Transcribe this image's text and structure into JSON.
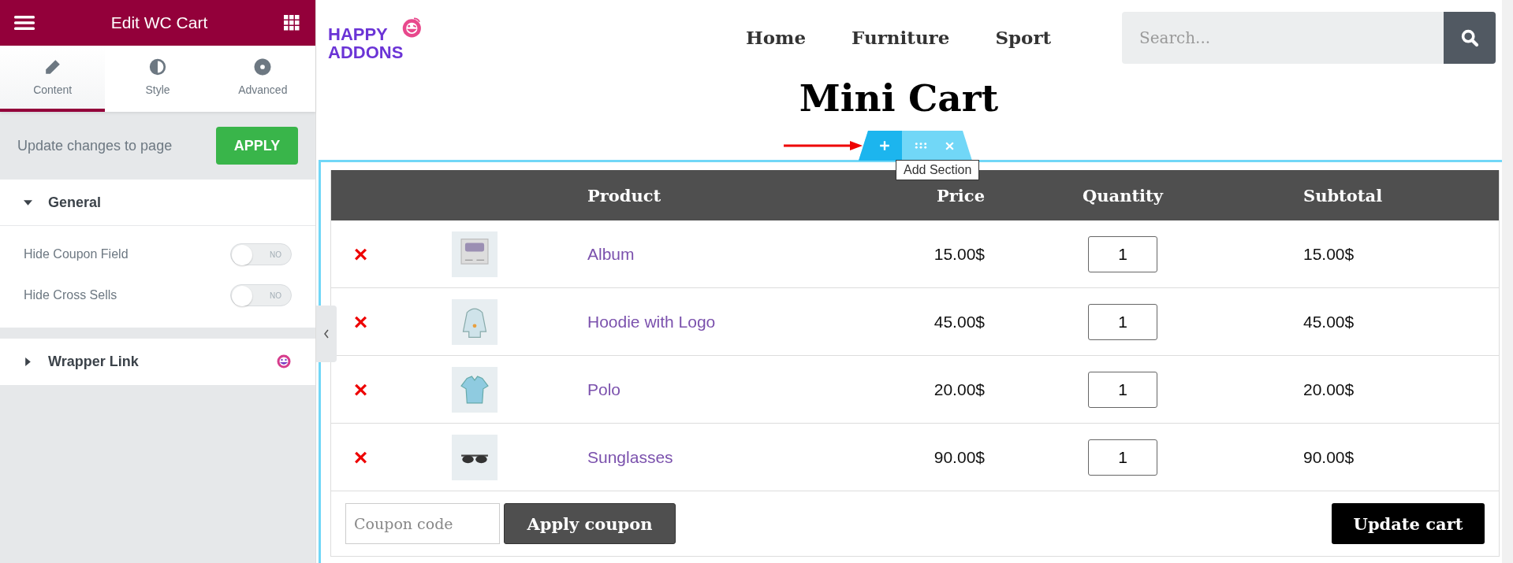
{
  "panel": {
    "title": "Edit WC Cart",
    "tabs": [
      {
        "label": "Content",
        "selected": true
      },
      {
        "label": "Style",
        "selected": false
      },
      {
        "label": "Advanced",
        "selected": false
      }
    ],
    "apply_bar": {
      "text": "Update changes to page",
      "button": "APPLY"
    },
    "sections": [
      {
        "title": "General",
        "expanded": true,
        "badge": false,
        "controls": [
          {
            "label": "Hide Coupon Field",
            "on": false,
            "state_text": "NO"
          },
          {
            "label": "Hide Cross Sells",
            "on": false,
            "state_text": "NO"
          }
        ]
      },
      {
        "title": "Wrapper Link",
        "expanded": false,
        "badge": true
      }
    ]
  },
  "site": {
    "logo": [
      "HAPPY",
      "ADDONS"
    ],
    "nav": [
      "Home",
      "Furniture",
      "Sport"
    ],
    "search": {
      "placeholder": "Search..."
    }
  },
  "page_title": "Mini Cart",
  "section_handle": {
    "tooltip": "Add Section"
  },
  "cart": {
    "columns": [
      "",
      "",
      "Product",
      "Price",
      "Quantity",
      "Subtotal"
    ],
    "rows": [
      {
        "remove": "×",
        "product": "Album",
        "price": "15.00$",
        "quantity": "1",
        "subtotal": "15.00$"
      },
      {
        "remove": "×",
        "product": "Hoodie with Logo",
        "price": "45.00$",
        "quantity": "1",
        "subtotal": "45.00$"
      },
      {
        "remove": "×",
        "product": "Polo",
        "price": "20.00$",
        "quantity": "1",
        "subtotal": "20.00$"
      },
      {
        "remove": "×",
        "product": "Sunglasses",
        "price": "90.00$",
        "quantity": "1",
        "subtotal": "90.00$"
      }
    ],
    "coupon": {
      "placeholder": "Coupon code",
      "button": "Apply coupon"
    },
    "update_button": "Update cart"
  }
}
